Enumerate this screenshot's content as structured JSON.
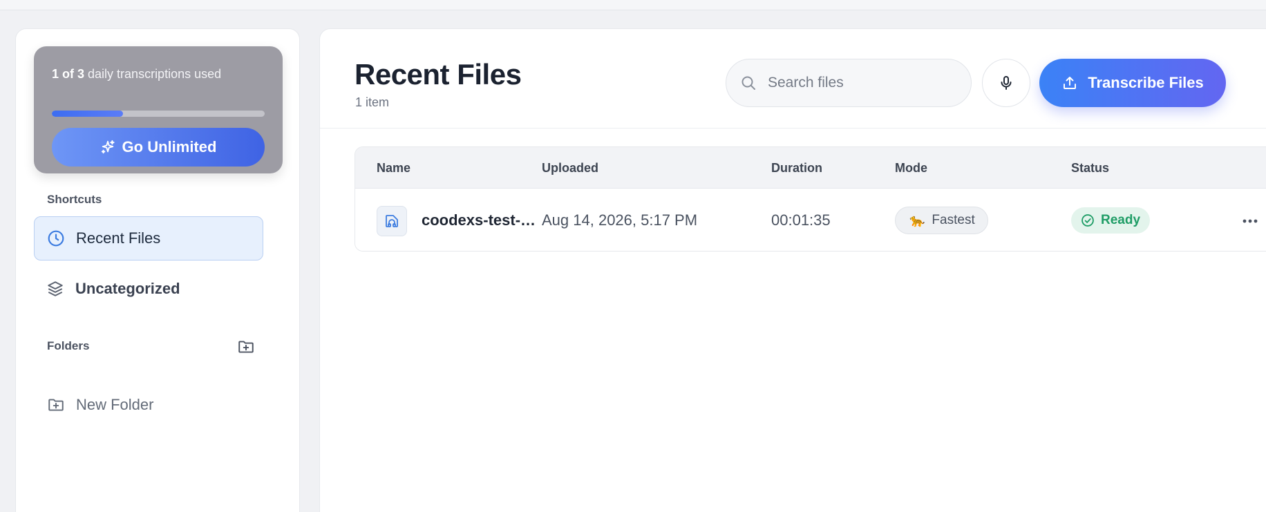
{
  "sidebar": {
    "usage": {
      "used_label": "1 of 3",
      "suffix": "daily transcriptions used",
      "used": 1,
      "total": 3
    },
    "upgrade_label": "Go Unlimited",
    "shortcuts_label": "Shortcuts",
    "shortcuts": [
      {
        "label": "Recent Files",
        "icon": "clock-icon",
        "active": true
      },
      {
        "label": "Uncategorized",
        "icon": "layers-icon",
        "active": false
      }
    ],
    "folders_label": "Folders",
    "new_folder_label": "New Folder"
  },
  "main": {
    "title": "Recent Files",
    "count": "1 item",
    "search_placeholder": "Search files",
    "transcribe_label": "Transcribe Files",
    "columns": [
      "Name",
      "Uploaded",
      "Duration",
      "Mode",
      "Status"
    ],
    "rows": [
      {
        "name": "coodexs-test-s...",
        "uploaded": "Aug 14, 2026, 5:17 PM",
        "duration": "00:01:35",
        "mode": "Fastest",
        "mode_icon": "🐆",
        "status": "Ready"
      }
    ]
  },
  "colors": {
    "accent": "#3b82f6",
    "accent_end": "#6366f1",
    "ready": "#1f9d66"
  }
}
